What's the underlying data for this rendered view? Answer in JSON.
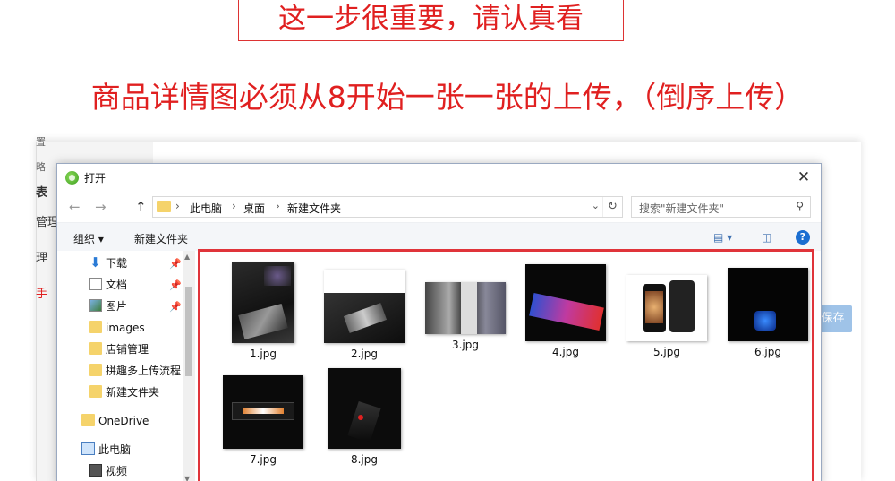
{
  "banner": {
    "headline": "这一步很重要，请认真看",
    "instruction": "商品详情图必须从8开始一张一张的上传，（倒序上传）"
  },
  "background_page": {
    "left_labels": [
      "置",
      "略",
      "表",
      "管理",
      "理",
      "手"
    ],
    "save_button": "保存"
  },
  "dialog": {
    "title": "打开",
    "close": "✕",
    "address": {
      "crumbs": [
        "此电脑",
        "桌面",
        "新建文件夹"
      ],
      "search_placeholder": "搜索\"新建文件夹\""
    },
    "toolbar": {
      "organize": "组织 ▾",
      "new_folder": "新建文件夹"
    },
    "nav": [
      {
        "label": "下载",
        "icon": "download-arrow-icon",
        "pinned": true
      },
      {
        "label": "文档",
        "icon": "document-icon",
        "pinned": true
      },
      {
        "label": "图片",
        "icon": "pictures-icon",
        "pinned": true
      },
      {
        "label": "images",
        "icon": "folder-icon",
        "pinned": false
      },
      {
        "label": "店铺管理",
        "icon": "folder-icon",
        "pinned": false
      },
      {
        "label": "拼趣多上传流程",
        "icon": "folder-icon",
        "pinned": false
      },
      {
        "label": "新建文件夹",
        "icon": "folder-icon",
        "pinned": false
      },
      {
        "label": "OneDrive",
        "icon": "onedrive-icon",
        "pinned": false
      },
      {
        "label": "此电脑",
        "icon": "computer-icon",
        "pinned": false
      },
      {
        "label": "视频",
        "icon": "video-icon",
        "pinned": false
      }
    ],
    "files": [
      {
        "name": "1.jpg"
      },
      {
        "name": "2.jpg"
      },
      {
        "name": "3.jpg"
      },
      {
        "name": "4.jpg"
      },
      {
        "name": "5.jpg"
      },
      {
        "name": "6.jpg"
      },
      {
        "name": "7.jpg"
      },
      {
        "name": "8.jpg"
      }
    ]
  },
  "colors": {
    "banner_red": "#e02020",
    "highlight_border": "#e0343a",
    "help_blue": "#1b6ed1"
  }
}
